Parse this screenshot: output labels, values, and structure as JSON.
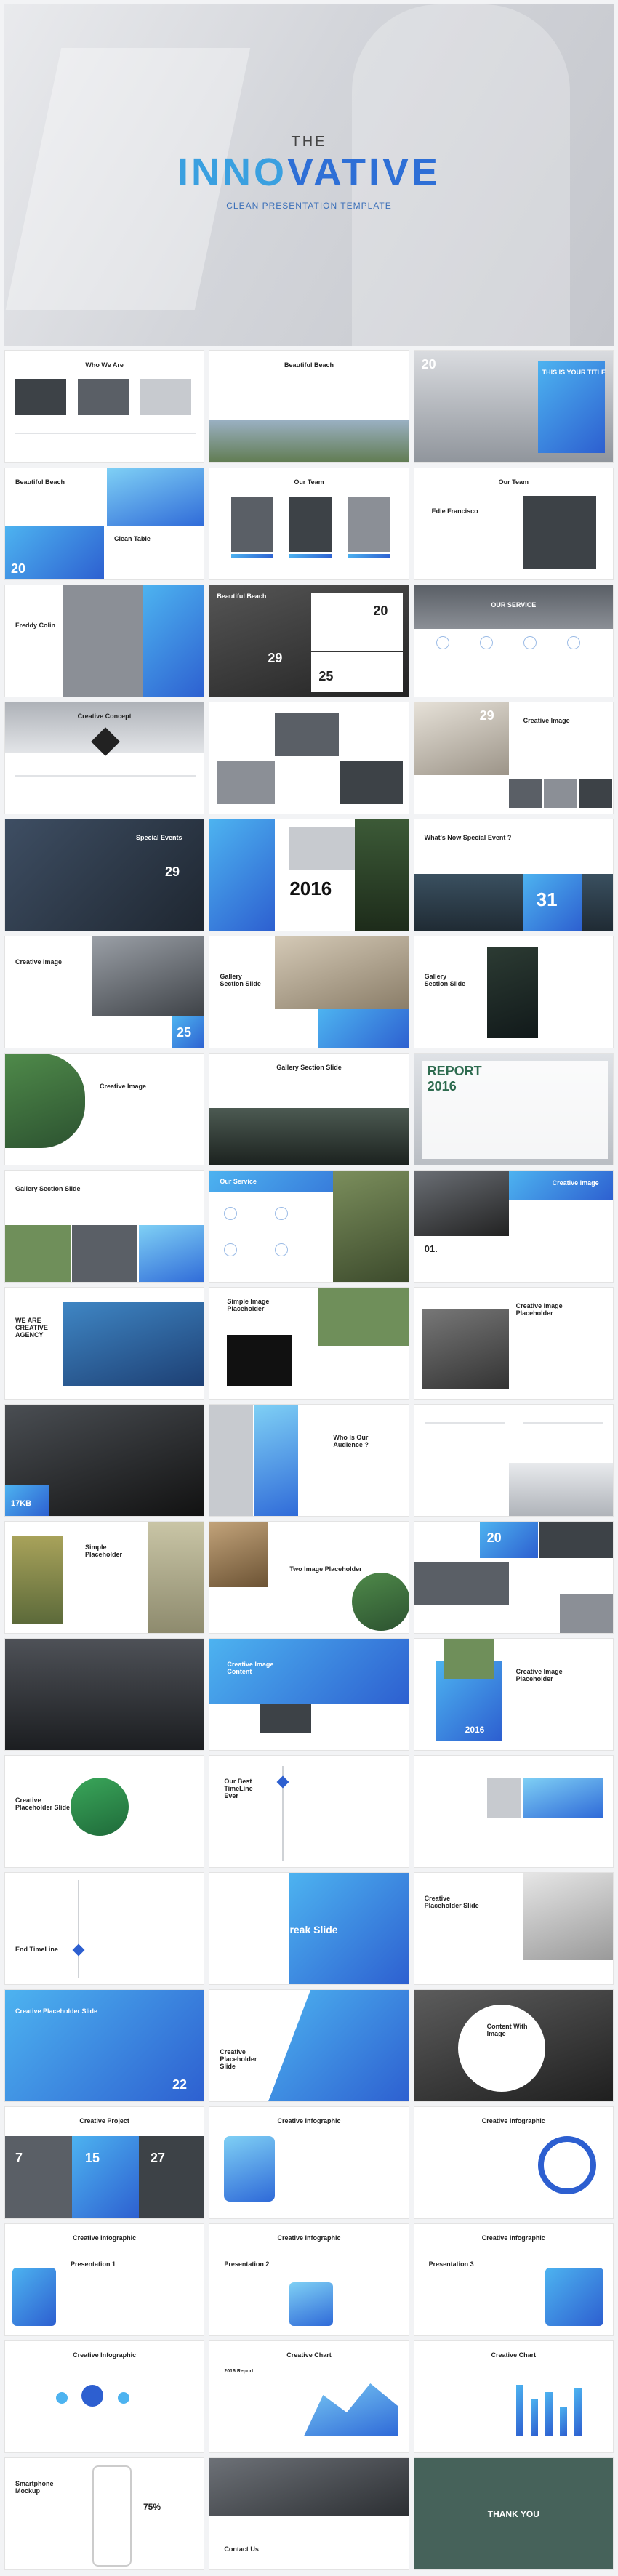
{
  "cover": {
    "pre_title": "THE",
    "title_a": "INNO",
    "title_b": "VATIVE",
    "subtitle": "CLEAN PRESENTATION TEMPLATE"
  },
  "slides": [
    {
      "title": "Who We Are"
    },
    {
      "title": "Beautiful Beach"
    },
    {
      "title": "THIS IS YOUR TITLE",
      "num": "20"
    },
    {
      "title": "Beautiful Beach",
      "sub": "Clean Table",
      "num": "20"
    },
    {
      "title": "Our Team"
    },
    {
      "title": "Our Team",
      "sub": "Edie Francisco"
    },
    {
      "title": "Freddy Colin"
    },
    {
      "title": "Beautiful Beach",
      "num": "29",
      "num2": "25",
      "num3": "20"
    },
    {
      "title": "OUR SERVICE"
    },
    {
      "title": "Creative Concept"
    },
    {
      "title": ""
    },
    {
      "title": "Creative Image",
      "num": "29"
    },
    {
      "title": "Special Events",
      "num": "29"
    },
    {
      "title": "2016"
    },
    {
      "title": "What's Now Special Event ?",
      "num": "31"
    },
    {
      "title": "Creative Image",
      "num": "25"
    },
    {
      "title": "Gallery Section Slide"
    },
    {
      "title": "Gallery Section Slide"
    },
    {
      "title": "Creative Image"
    },
    {
      "title": "Gallery Section Slide"
    },
    {
      "title": "REPORT 2016"
    },
    {
      "title": "Gallery Section Slide"
    },
    {
      "title": "Our Service"
    },
    {
      "title": "Creative Image",
      "sub": "01."
    },
    {
      "title": "WE ARE CREATIVE AGENCY"
    },
    {
      "title": "Simple Image Placeholder"
    },
    {
      "title": "Creative Image Placeholder"
    },
    {
      "title": "17KB"
    },
    {
      "title": "Who Is Our Audience ?"
    },
    {
      "title": ""
    },
    {
      "title": "Simple Placeholder"
    },
    {
      "title": "Two Image Placeholder"
    },
    {
      "title": "",
      "num": "20"
    },
    {
      "title": ""
    },
    {
      "title": "Creative Image Content"
    },
    {
      "title": "Creative Image Placeholder",
      "num": "2016"
    },
    {
      "title": "Creative Placeholder Slide"
    },
    {
      "title": "Our Best TimeLine Ever"
    },
    {
      "title": ""
    },
    {
      "title": "End TimeLine"
    },
    {
      "title": "Break Slide"
    },
    {
      "title": "Creative Placeholder Slide"
    },
    {
      "title": "Creative Placeholder Slide",
      "num": "22"
    },
    {
      "title": "Creative Placeholder Slide"
    },
    {
      "title": "Content With Image"
    },
    {
      "title": "Creative Project",
      "num": "7",
      "num2": "15",
      "num3": "27"
    },
    {
      "title": "Creative Infographic"
    },
    {
      "title": "Creative Infographic"
    },
    {
      "title": "Creative Infographic",
      "sub": "Presentation 1"
    },
    {
      "title": "Creative Infographic",
      "sub": "Presentation 2"
    },
    {
      "title": "Creative Infographic",
      "sub": "Presentation 3"
    },
    {
      "title": "Creative Infographic"
    },
    {
      "title": "Creative Chart",
      "sub": "2016 Report"
    },
    {
      "title": "Creative Chart"
    },
    {
      "title": "Smartphone Mockup",
      "num": "75%"
    },
    {
      "title": "Contact Us"
    },
    {
      "title": "THANK YOU"
    }
  ]
}
